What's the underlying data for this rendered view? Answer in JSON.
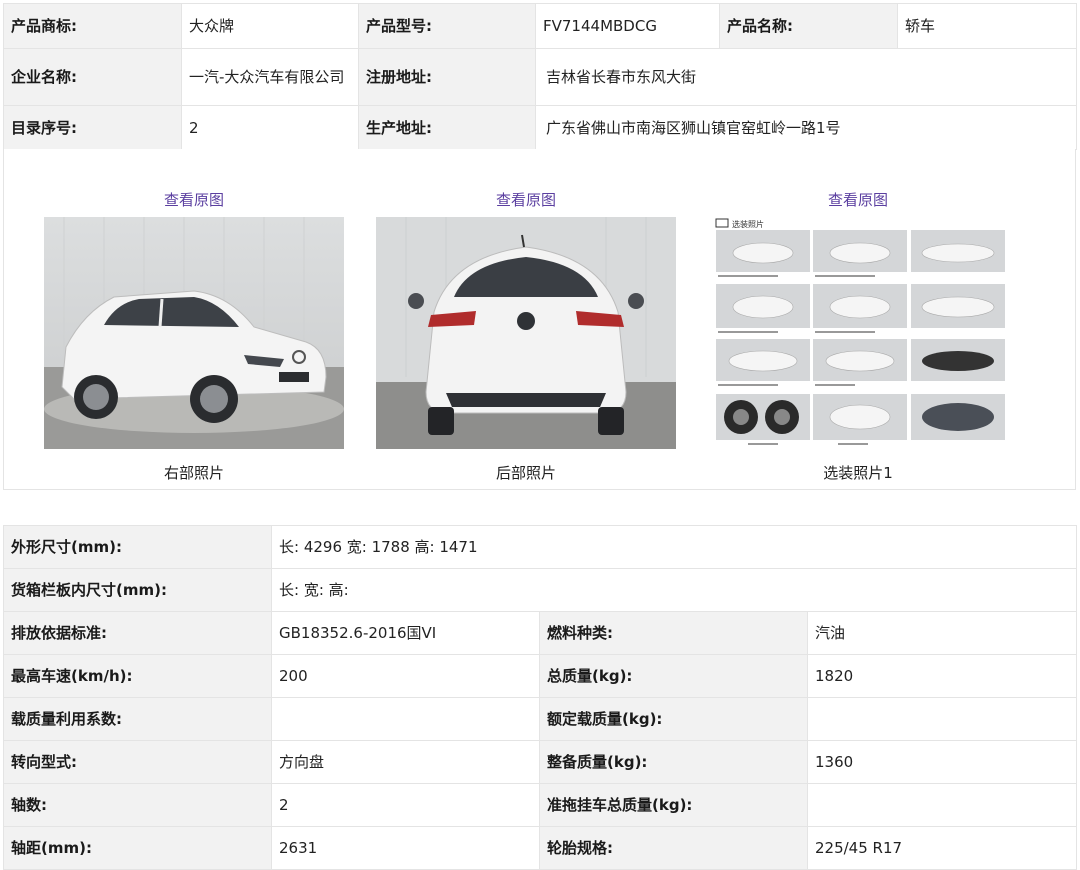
{
  "basic": {
    "brand_label": "产品商标:",
    "brand_value": "大众牌",
    "model_label": "产品型号:",
    "model_value": "FV7144MBDCG",
    "name_label": "产品名称:",
    "name_value": "轿车",
    "company_label": "企业名称:",
    "company_value": "一汽-大众汽车有限公司",
    "reg_addr_label": "注册地址:",
    "reg_addr_value": "吉林省长春市东风大街",
    "catalog_label": "目录序号:",
    "catalog_value": "2",
    "prod_addr_label": "生产地址:",
    "prod_addr_value": "广东省佛山市南海区狮山镇官窑虹岭一路1号"
  },
  "photos": [
    {
      "link": "查看原图",
      "caption": "右部照片"
    },
    {
      "link": "查看原图",
      "caption": "后部照片"
    },
    {
      "link": "查看原图",
      "caption": "选装照片1",
      "sheet_title": "选装照片"
    }
  ],
  "specs": {
    "dims_label": "外形尺寸(mm):",
    "dims_value": "长: 4296 宽: 1788 高: 1471",
    "cargo_label": "货箱栏板内尺寸(mm):",
    "cargo_value": "长:  宽:  高:",
    "emission_label": "排放依据标准:",
    "emission_value": "GB18352.6-2016国VI",
    "fuel_label": "燃料种类:",
    "fuel_value": "汽油",
    "speed_label": "最高车速(km/h):",
    "speed_value": "200",
    "gross_label": "总质量(kg):",
    "gross_value": "1820",
    "load_coef_label": "载质量利用系数:",
    "load_coef_value": "",
    "rated_load_label": "额定载质量(kg):",
    "rated_load_value": "",
    "steering_label": "转向型式:",
    "steering_value": "方向盘",
    "curb_label": "整备质量(kg):",
    "curb_value": "1360",
    "axles_label": "轴数:",
    "axles_value": "2",
    "trailer_label": "准拖挂车总质量(kg):",
    "trailer_value": "",
    "wheelbase_label": "轴距(mm):",
    "wheelbase_value": "2631",
    "tire_label": "轮胎规格:",
    "tire_value": "225/45 R17"
  },
  "colors": {
    "label_bg": "#f2f2f2",
    "border": "#e4e4e4",
    "link": "#5b3fa0"
  }
}
